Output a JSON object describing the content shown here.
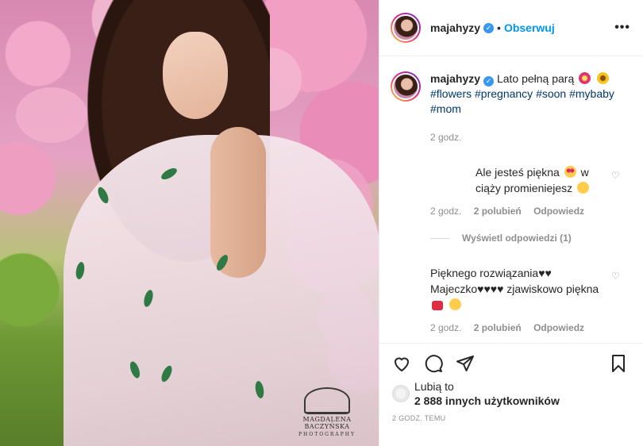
{
  "header": {
    "username": "majahyzy",
    "separator": "•",
    "follow_label": "Obserwuj",
    "more_label": "•••"
  },
  "caption": {
    "username": "majahyzy",
    "text": "Lato pełną parą",
    "hashtags": "#flowers #pregnancy #soon #mybaby #mom",
    "time": "2 godz."
  },
  "comments": [
    {
      "text_before": "Ale jesteś piękna",
      "text_after": "w ciąży promieniejesz",
      "time": "2 godz.",
      "likes": "2 polubień",
      "reply_label": "Odpowiedz",
      "view_replies": "Wyświetl odpowiedzi (1)"
    },
    {
      "text_before": "Pięknego rozwiązania♥♥ Majeczko♥♥♥♥ zjawiskowo piękna",
      "time": "2 godz.",
      "likes": "2 polubień",
      "reply_label": "Odpowiedz"
    }
  ],
  "photo": {
    "watermark_name": "MAGDALENA BACZYŃSKA",
    "watermark_sub": "PHOTOGRAPHY"
  },
  "likes": {
    "prefix": "Lubią to",
    "count_text": "2 888 innych użytkowników"
  },
  "timestamp": "2 GODZ. TEMU",
  "colors": {
    "accent": "#0095f6",
    "verified": "#3897f0",
    "hashtag": "#00376b",
    "muted": "#8e8e8e"
  },
  "icons": [
    "heart-icon",
    "comment-icon",
    "share-icon",
    "bookmark-icon",
    "verified-icon",
    "more-options-icon"
  ]
}
